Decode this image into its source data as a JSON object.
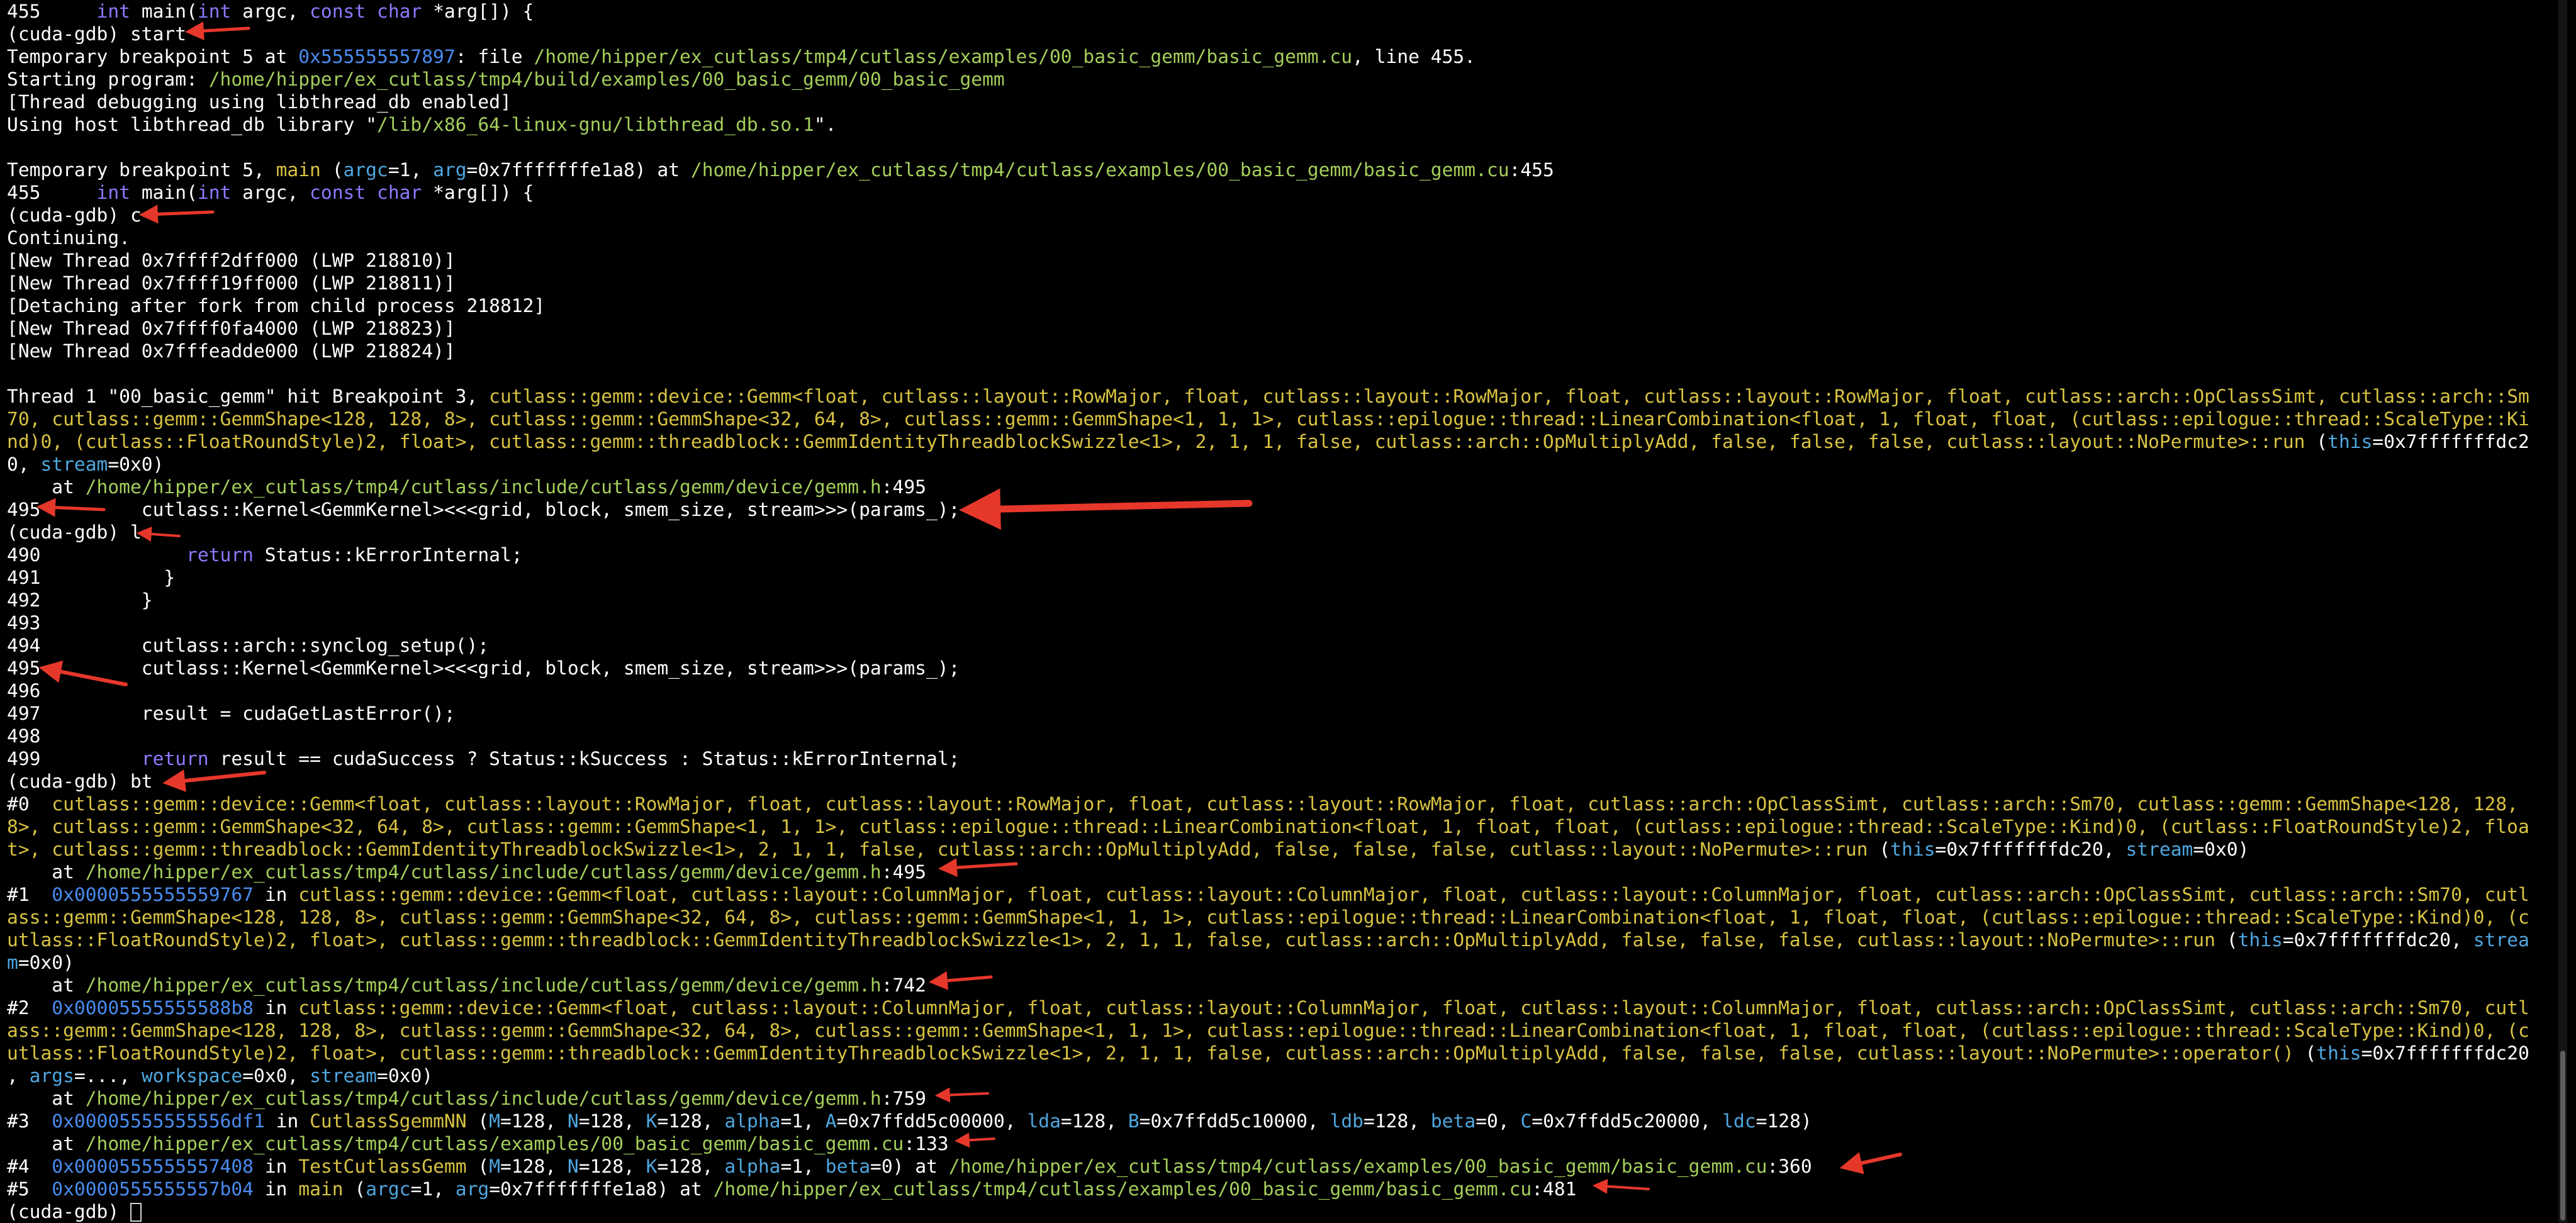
{
  "colors": {
    "background": "#000000",
    "text": "#ffffff",
    "keyword": "#8b7bff",
    "address": "#4a8cf0",
    "path": "#a4cf5b",
    "function": "#d8c342",
    "argument": "#4fa7e0",
    "annotation_arrow": "#e6372b"
  },
  "annotations": {
    "arrow_icon_count": 17
  },
  "lines": [
    [
      {
        "t": "455     "
      },
      {
        "t": "int",
        "c": "kw"
      },
      {
        "t": " main("
      },
      {
        "t": "int",
        "c": "kw"
      },
      {
        "t": " argc, "
      },
      {
        "t": "const",
        "c": "kw"
      },
      {
        "t": " "
      },
      {
        "t": "char",
        "c": "kw"
      },
      {
        "t": " *arg[]) {"
      }
    ],
    [
      {
        "t": "(cuda-gdb) start"
      }
    ],
    [
      {
        "t": "Temporary breakpoint 5 at "
      },
      {
        "t": "0x555555557897",
        "c": "hex"
      },
      {
        "t": ": file "
      },
      {
        "t": "/home/hipper/ex_cutlass/tmp4/cutlass/examples/00_basic_gemm/basic_gemm.cu",
        "c": "path"
      },
      {
        "t": ", line 455."
      }
    ],
    [
      {
        "t": "Starting program: "
      },
      {
        "t": "/home/hipper/ex_cutlass/tmp4/build/examples/00_basic_gemm/00_basic_gemm",
        "c": "path"
      }
    ],
    [
      {
        "t": "[Thread debugging using libthread_db enabled]"
      }
    ],
    [
      {
        "t": "Using host libthread_db library \""
      },
      {
        "t": "/lib/x86_64-linux-gnu/libthread_db.so.1",
        "c": "path"
      },
      {
        "t": "\"."
      }
    ],
    [
      {
        "t": ""
      }
    ],
    [
      {
        "t": "Temporary breakpoint 5, "
      },
      {
        "t": "main",
        "c": "fn"
      },
      {
        "t": " ("
      },
      {
        "t": "argc",
        "c": "arg"
      },
      {
        "t": "=1, "
      },
      {
        "t": "arg",
        "c": "arg"
      },
      {
        "t": "=0x7fffffffe1a8) at "
      },
      {
        "t": "/home/hipper/ex_cutlass/tmp4/cutlass/examples/00_basic_gemm/basic_gemm.cu",
        "c": "path"
      },
      {
        "t": ":455"
      }
    ],
    [
      {
        "t": "455     "
      },
      {
        "t": "int",
        "c": "kw"
      },
      {
        "t": " main("
      },
      {
        "t": "int",
        "c": "kw"
      },
      {
        "t": " argc, "
      },
      {
        "t": "const",
        "c": "kw"
      },
      {
        "t": " "
      },
      {
        "t": "char",
        "c": "kw"
      },
      {
        "t": " *arg[]) {"
      }
    ],
    [
      {
        "t": "(cuda-gdb) c"
      }
    ],
    [
      {
        "t": "Continuing."
      }
    ],
    [
      {
        "t": "[New Thread 0x7ffff2dff000 (LWP 218810)]"
      }
    ],
    [
      {
        "t": "[New Thread 0x7ffff19ff000 (LWP 218811)]"
      }
    ],
    [
      {
        "t": "[Detaching after fork from child process 218812]"
      }
    ],
    [
      {
        "t": "[New Thread 0x7ffff0fa4000 (LWP 218823)]"
      }
    ],
    [
      {
        "t": "[New Thread 0x7fffeadde000 (LWP 218824)]"
      }
    ],
    [
      {
        "t": ""
      }
    ],
    [
      {
        "t": "Thread 1 \"00_basic_gemm\" hit Breakpoint 3, "
      },
      {
        "t": "cutlass::gemm::device::Gemm<float, cutlass::layout::RowMajor, float, cutlass::layout::RowMajor, float, cutlass::layout::RowMajor, float, cutlass::arch::OpClassSimt, cutlass::arch::Sm",
        "c": "fn"
      }
    ],
    [
      {
        "t": "70, cutlass::gemm::GemmShape<128, 128, 8>, cutlass::gemm::GemmShape<32, 64, 8>, cutlass::gemm::GemmShape<1, 1, 1>, cutlass::epilogue::thread::LinearCombination<float, 1, float, float, (cutlass::epilogue::thread::ScaleType::Ki",
        "c": "fn"
      }
    ],
    [
      {
        "t": "nd)0, (cutlass::FloatRoundStyle)2, float>, cutlass::gemm::threadblock::GemmIdentityThreadblockSwizzle<1>, 2, 1, 1, false, cutlass::arch::OpMultiplyAdd, false, false, false, cutlass::layout::NoPermute>::run",
        "c": "fn"
      },
      {
        "t": " ("
      },
      {
        "t": "this",
        "c": "arg"
      },
      {
        "t": "=0x7fffffffdc2"
      }
    ],
    [
      {
        "t": "0, "
      },
      {
        "t": "stream",
        "c": "arg"
      },
      {
        "t": "=0x0)"
      }
    ],
    [
      {
        "t": "    at "
      },
      {
        "t": "/home/hipper/ex_cutlass/tmp4/cutlass/include/cutlass/gemm/device/gemm.h",
        "c": "path"
      },
      {
        "t": ":495"
      }
    ],
    [
      {
        "t": "495         cutlass::Kernel<GemmKernel><<<grid, block, smem_size, stream>>>(params_);"
      }
    ],
    [
      {
        "t": "(cuda-gdb) l"
      }
    ],
    [
      {
        "t": "490             "
      },
      {
        "t": "return",
        "c": "kw"
      },
      {
        "t": " Status::kErrorInternal;"
      }
    ],
    [
      {
        "t": "491           }"
      }
    ],
    [
      {
        "t": "492         }"
      }
    ],
    [
      {
        "t": "493"
      }
    ],
    [
      {
        "t": "494         cutlass::arch::synclog_setup();"
      }
    ],
    [
      {
        "t": "495         cutlass::Kernel<GemmKernel><<<grid, block, smem_size, stream>>>(params_);"
      }
    ],
    [
      {
        "t": "496"
      }
    ],
    [
      {
        "t": "497         result = cudaGetLastError();"
      }
    ],
    [
      {
        "t": "498"
      }
    ],
    [
      {
        "t": "499         "
      },
      {
        "t": "return",
        "c": "kw"
      },
      {
        "t": " result == cudaSuccess ? Status::kSuccess : Status::kErrorInternal;"
      }
    ],
    [
      {
        "t": "(cuda-gdb) bt"
      }
    ],
    [
      {
        "t": "#0  "
      },
      {
        "t": "cutlass::gemm::device::Gemm<float, cutlass::layout::RowMajor, float, cutlass::layout::RowMajor, float, cutlass::layout::RowMajor, float, cutlass::arch::OpClassSimt, cutlass::arch::Sm70, cutlass::gemm::GemmShape<128, 128,",
        "c": "fn"
      }
    ],
    [
      {
        "t": "8>, cutlass::gemm::GemmShape<32, 64, 8>, cutlass::gemm::GemmShape<1, 1, 1>, cutlass::epilogue::thread::LinearCombination<float, 1, float, float, (cutlass::epilogue::thread::ScaleType::Kind)0, (cutlass::FloatRoundStyle)2, floa",
        "c": "fn"
      }
    ],
    [
      {
        "t": "t>, cutlass::gemm::threadblock::GemmIdentityThreadblockSwizzle<1>, 2, 1, 1, false, cutlass::arch::OpMultiplyAdd, false, false, false, cutlass::layout::NoPermute>::run",
        "c": "fn"
      },
      {
        "t": " ("
      },
      {
        "t": "this",
        "c": "arg"
      },
      {
        "t": "=0x7fffffffdc20, "
      },
      {
        "t": "stream",
        "c": "arg"
      },
      {
        "t": "=0x0)"
      }
    ],
    [
      {
        "t": "    at "
      },
      {
        "t": "/home/hipper/ex_cutlass/tmp4/cutlass/include/cutlass/gemm/device/gemm.h",
        "c": "path"
      },
      {
        "t": ":495"
      }
    ],
    [
      {
        "t": "#1  "
      },
      {
        "t": "0x0000555555559767",
        "c": "hex"
      },
      {
        "t": " in "
      },
      {
        "t": "cutlass::gemm::device::Gemm<float, cutlass::layout::ColumnMajor, float, cutlass::layout::ColumnMajor, float, cutlass::layout::ColumnMajor, float, cutlass::arch::OpClassSimt, cutlass::arch::Sm70, cutl",
        "c": "fn"
      }
    ],
    [
      {
        "t": "ass::gemm::GemmShape<128, 128, 8>, cutlass::gemm::GemmShape<32, 64, 8>, cutlass::gemm::GemmShape<1, 1, 1>, cutlass::epilogue::thread::LinearCombination<float, 1, float, float, (cutlass::epilogue::thread::ScaleType::Kind)0, (c",
        "c": "fn"
      }
    ],
    [
      {
        "t": "utlass::FloatRoundStyle)2, float>, cutlass::gemm::threadblock::GemmIdentityThreadblockSwizzle<1>, 2, 1, 1, false, cutlass::arch::OpMultiplyAdd, false, false, false, cutlass::layout::NoPermute>::run",
        "c": "fn"
      },
      {
        "t": " ("
      },
      {
        "t": "this",
        "c": "arg"
      },
      {
        "t": "=0x7fffffffdc20, "
      },
      {
        "t": "strea",
        "c": "arg"
      }
    ],
    [
      {
        "t": "m",
        "c": "arg"
      },
      {
        "t": "=0x0)"
      }
    ],
    [
      {
        "t": "    at "
      },
      {
        "t": "/home/hipper/ex_cutlass/tmp4/cutlass/include/cutlass/gemm/device/gemm.h",
        "c": "path"
      },
      {
        "t": ":742"
      }
    ],
    [
      {
        "t": "#2  "
      },
      {
        "t": "0x00005555555588b8",
        "c": "hex"
      },
      {
        "t": " in "
      },
      {
        "t": "cutlass::gemm::device::Gemm<float, cutlass::layout::ColumnMajor, float, cutlass::layout::ColumnMajor, float, cutlass::layout::ColumnMajor, float, cutlass::arch::OpClassSimt, cutlass::arch::Sm70, cutl",
        "c": "fn"
      }
    ],
    [
      {
        "t": "ass::gemm::GemmShape<128, 128, 8>, cutlass::gemm::GemmShape<32, 64, 8>, cutlass::gemm::GemmShape<1, 1, 1>, cutlass::epilogue::thread::LinearCombination<float, 1, float, float, (cutlass::epilogue::thread::ScaleType::Kind)0, (c",
        "c": "fn"
      }
    ],
    [
      {
        "t": "utlass::FloatRoundStyle)2, float>, cutlass::gemm::threadblock::GemmIdentityThreadblockSwizzle<1>, 2, 1, 1, false, cutlass::arch::OpMultiplyAdd, false, false, false, cutlass::layout::NoPermute>::operator()",
        "c": "fn"
      },
      {
        "t": " ("
      },
      {
        "t": "this",
        "c": "arg"
      },
      {
        "t": "=0x7fffffffdc20"
      }
    ],
    [
      {
        "t": ", "
      },
      {
        "t": "args",
        "c": "arg"
      },
      {
        "t": "=..., "
      },
      {
        "t": "workspace",
        "c": "arg"
      },
      {
        "t": "=0x0, "
      },
      {
        "t": "stream",
        "c": "arg"
      },
      {
        "t": "=0x0)"
      }
    ],
    [
      {
        "t": "    at "
      },
      {
        "t": "/home/hipper/ex_cutlass/tmp4/cutlass/include/cutlass/gemm/device/gemm.h",
        "c": "path"
      },
      {
        "t": ":759"
      }
    ],
    [
      {
        "t": "#3  "
      },
      {
        "t": "0x00005555555556df1",
        "c": "hex"
      },
      {
        "t": " in "
      },
      {
        "t": "CutlassSgemmNN",
        "c": "fn"
      },
      {
        "t": " ("
      },
      {
        "t": "M",
        "c": "arg"
      },
      {
        "t": "=128, "
      },
      {
        "t": "N",
        "c": "arg"
      },
      {
        "t": "=128, "
      },
      {
        "t": "K",
        "c": "arg"
      },
      {
        "t": "=128, "
      },
      {
        "t": "alpha",
        "c": "arg"
      },
      {
        "t": "=1, "
      },
      {
        "t": "A",
        "c": "arg"
      },
      {
        "t": "=0x7ffdd5c00000, "
      },
      {
        "t": "lda",
        "c": "arg"
      },
      {
        "t": "=128, "
      },
      {
        "t": "B",
        "c": "arg"
      },
      {
        "t": "=0x7ffdd5c10000, "
      },
      {
        "t": "ldb",
        "c": "arg"
      },
      {
        "t": "=128, "
      },
      {
        "t": "beta",
        "c": "arg"
      },
      {
        "t": "=0, "
      },
      {
        "t": "C",
        "c": "arg"
      },
      {
        "t": "=0x7ffdd5c20000, "
      },
      {
        "t": "ldc",
        "c": "arg"
      },
      {
        "t": "=128)"
      }
    ],
    [
      {
        "t": "    at "
      },
      {
        "t": "/home/hipper/ex_cutlass/tmp4/cutlass/examples/00_basic_gemm/basic_gemm.cu",
        "c": "path"
      },
      {
        "t": ":133"
      }
    ],
    [
      {
        "t": "#4  "
      },
      {
        "t": "0x0000555555557408",
        "c": "hex"
      },
      {
        "t": " in "
      },
      {
        "t": "TestCutlassGemm",
        "c": "fn"
      },
      {
        "t": " ("
      },
      {
        "t": "M",
        "c": "arg"
      },
      {
        "t": "=128, "
      },
      {
        "t": "N",
        "c": "arg"
      },
      {
        "t": "=128, "
      },
      {
        "t": "K",
        "c": "arg"
      },
      {
        "t": "=128, "
      },
      {
        "t": "alpha",
        "c": "arg"
      },
      {
        "t": "=1, "
      },
      {
        "t": "beta",
        "c": "arg"
      },
      {
        "t": "=0) at "
      },
      {
        "t": "/home/hipper/ex_cutlass/tmp4/cutlass/examples/00_basic_gemm/basic_gemm.cu",
        "c": "path"
      },
      {
        "t": ":360"
      }
    ],
    [
      {
        "t": "#5  "
      },
      {
        "t": "0x0000555555557b04",
        "c": "hex"
      },
      {
        "t": " in "
      },
      {
        "t": "main",
        "c": "fn"
      },
      {
        "t": " ("
      },
      {
        "t": "argc",
        "c": "arg"
      },
      {
        "t": "=1, "
      },
      {
        "t": "arg",
        "c": "arg"
      },
      {
        "t": "=0x7fffffffe1a8) at "
      },
      {
        "t": "/home/hipper/ex_cutlass/tmp4/cutlass/examples/00_basic_gemm/basic_gemm.cu",
        "c": "path"
      },
      {
        "t": ":481"
      }
    ],
    [
      {
        "t": "(cuda-gdb) "
      }
    ]
  ]
}
